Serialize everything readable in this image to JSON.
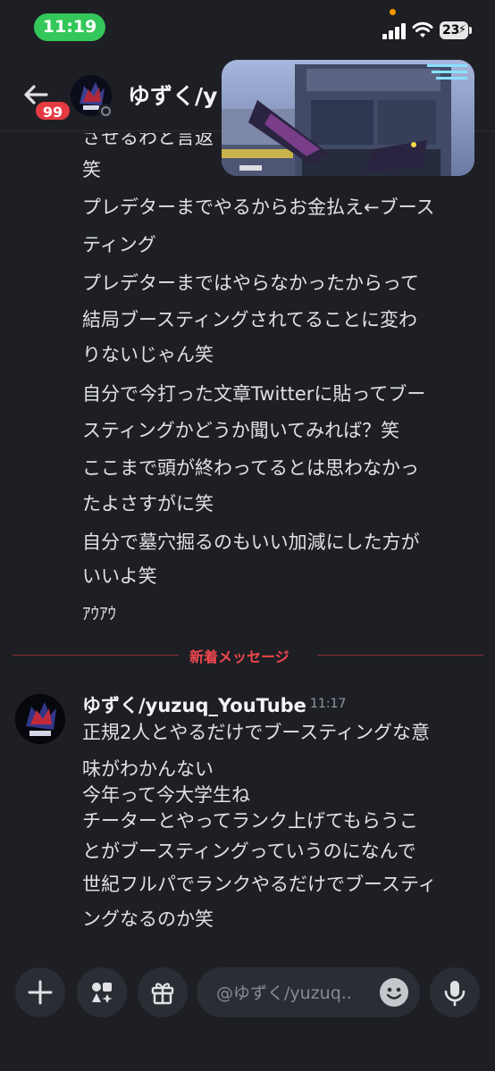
{
  "status_bar": {
    "time": "11:19",
    "battery": "23"
  },
  "header": {
    "unread_badge": "99",
    "channel_title": "ゆずく/y"
  },
  "messages_previous": [
    "させるわと言返",
    "笑",
    "プレデターまでやるからお金払え←ブース",
    "ティング",
    "プレデターまではやらなかったからって",
    "結局ブースティングされてることに変わ",
    "りないじゃん笑",
    "自分で今打った文章Twitterに貼ってブー",
    "スティングかどうか聞いてみれば？笑",
    "ここまで頭が終わってるとは思わなかっ",
    "たよさすがに笑",
    "自分で墓穴掘るのもいい加減にした方が",
    "いいよ笑",
    "ｱｳｱｳ"
  ],
  "new_messages_label": "新着メッセージ",
  "new_message": {
    "author": "ゆずく/yuzuq_YouTube",
    "time": "11:17",
    "lines": [
      "正規2人とやるだけでブースティングな意",
      "味がわかんない",
      "今年って今大学生ね",
      "チーターとやってランク上げてもらうこ",
      "とがブースティングっていうのになんで",
      "世紀フルパでランクやるだけでブースティ",
      "ングなるのか笑"
    ]
  },
  "composer": {
    "placeholder": "@ゆずく/yuzuq.."
  },
  "icons": [
    "back-arrow-icon",
    "plus-icon",
    "apps-icon",
    "gift-icon",
    "emoji-icon",
    "microphone-icon",
    "wifi-icon",
    "signal-icon",
    "battery-icon"
  ]
}
